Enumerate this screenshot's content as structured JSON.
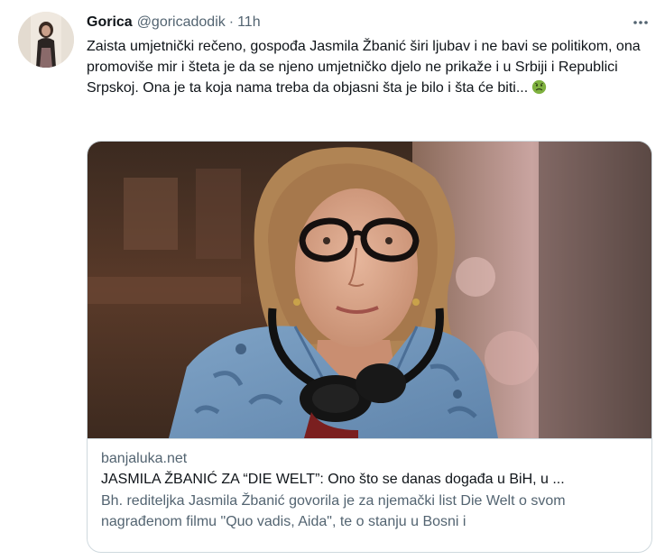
{
  "tweet": {
    "display_name": "Gorica",
    "handle": "@goricadodik",
    "dot": "·",
    "time": "11h",
    "text": "Zaista umjetnički rečeno, gospođa Jasmila Žbanić širi ljubav i ne bavi se politikom, ona promoviše mir i šteta je da se njeno umjetničko djelo ne prikaže i u Srbiji i Republici Srpskoj. Ona je ta koja nama treba da objasni šta je bilo i šta će biti...",
    "emoji_icon": "nauseated-face-icon"
  },
  "card": {
    "domain": "banjaluka.net",
    "title": "JASMILA ŽBANIĆ ZA “DIE WELT”: Ono što se danas događa u BiH, u ...",
    "description": "Bh. rediteljka Jasmila Žbanić govorila je za njemački list Die Welt o svom nagrađenom filmu \"Quo vadis, Aida\", te o stanju u Bosni i"
  },
  "colors": {
    "text_primary": "#0f1419",
    "text_secondary": "#536471",
    "border": "#cfd9de",
    "shirt": "#6f93b6"
  },
  "icons": {
    "more": "more-horizontal-icon",
    "emoji": "nauseated-face-icon"
  }
}
